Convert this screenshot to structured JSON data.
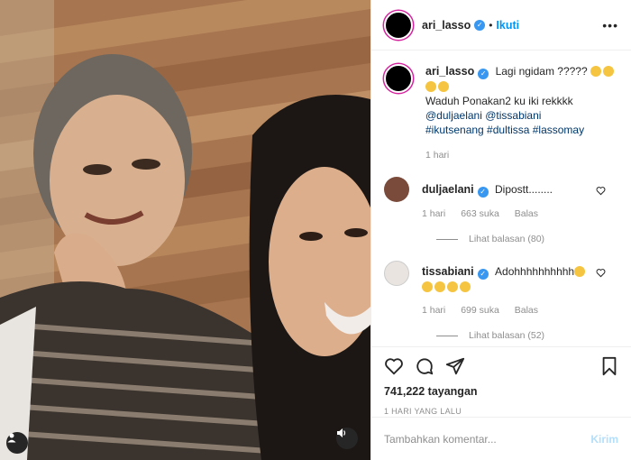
{
  "header": {
    "username": "ari_lasso",
    "separator": "•",
    "follow_label": "Ikuti",
    "more_label": "•••"
  },
  "caption": {
    "username": "ari_lasso",
    "text_line1": "Lagi ngidam ?????",
    "text_line2": "Waduh Ponakan2 ku iki rekkkk",
    "mentions": "@duljaelani @tissabiani",
    "hashtags": "#ikutsenang #dultissa #lassomay",
    "time": "1 hari"
  },
  "comments": [
    {
      "username": "duljaelani",
      "text": "Dipostt........",
      "time": "1 hari",
      "likes": "663 suka",
      "reply_label": "Balas",
      "view_replies": "Lihat balasan (80)"
    },
    {
      "username": "tissabiani",
      "text": "Adohhhhhhhhhh",
      "time": "1 hari",
      "likes": "699 suka",
      "reply_label": "Balas",
      "view_replies": "Lihat balasan (52)"
    }
  ],
  "stats": {
    "views": "741,222 tayangan",
    "date": "1 HARI YANG LALU"
  },
  "add_comment": {
    "placeholder": "Tambahkan komentar...",
    "send_label": "Kirim"
  },
  "icons": {
    "like": "heart-icon",
    "comment": "comment-icon",
    "share": "paper-plane-icon",
    "save": "bookmark-icon",
    "tags": "user-tag-icon",
    "sound": "speaker-icon"
  },
  "colors": {
    "accent": "#0095f6",
    "verified": "#3897f0",
    "muted": "#8e8e8e",
    "link": "#00376b"
  }
}
